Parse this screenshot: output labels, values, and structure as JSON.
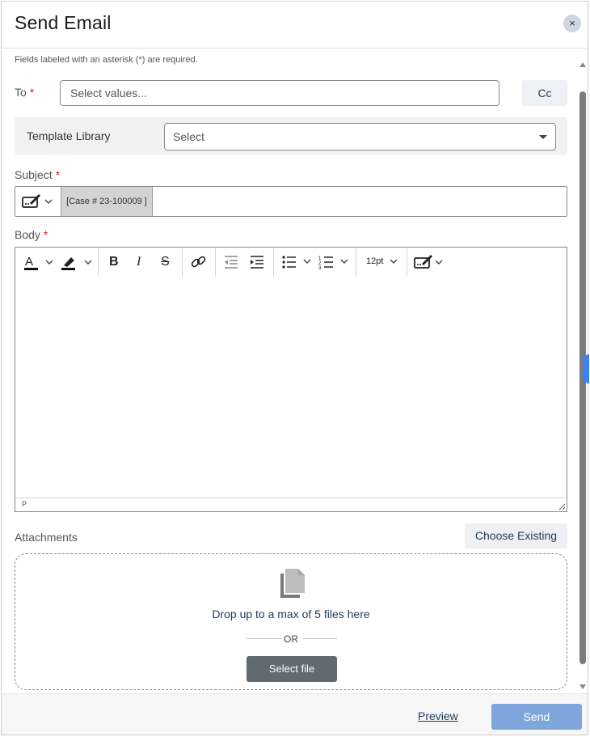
{
  "dialog": {
    "title": "Send Email",
    "close_label": "×"
  },
  "form": {
    "required_note": "Fields labeled with an asterisk (*) are required.",
    "to": {
      "label": "To",
      "required_mark": "*",
      "placeholder": "Select values...",
      "cc_label": "Cc"
    },
    "template": {
      "label": "Template Library",
      "placeholder": "Select"
    },
    "subject": {
      "label": "Subject",
      "required_mark": "*",
      "token": "[Case # 23-100009 ]",
      "value": ""
    },
    "body": {
      "label": "Body",
      "required_mark": "*",
      "font_size": "12pt",
      "status_path": "P",
      "toolbar_icons": [
        "text-color-icon",
        "highlight-icon",
        "bold-icon",
        "italic-icon",
        "strikethrough-icon",
        "link-icon",
        "outdent-icon",
        "indent-icon",
        "bullet-list-icon",
        "numbered-list-icon",
        "font-size-select",
        "signature-icon"
      ]
    },
    "attachments": {
      "label": "Attachments",
      "choose_existing": "Choose Existing",
      "drop_text": "Drop up to a max of 5 files here",
      "or_text": "OR",
      "select_file": "Select file"
    }
  },
  "footer": {
    "preview_label": "Preview",
    "send_label": "Send"
  },
  "colors": {
    "accent": "#1f3a5a",
    "send_button": "#7fa6dc",
    "select_file_button": "#616971",
    "required": "#c62828"
  }
}
